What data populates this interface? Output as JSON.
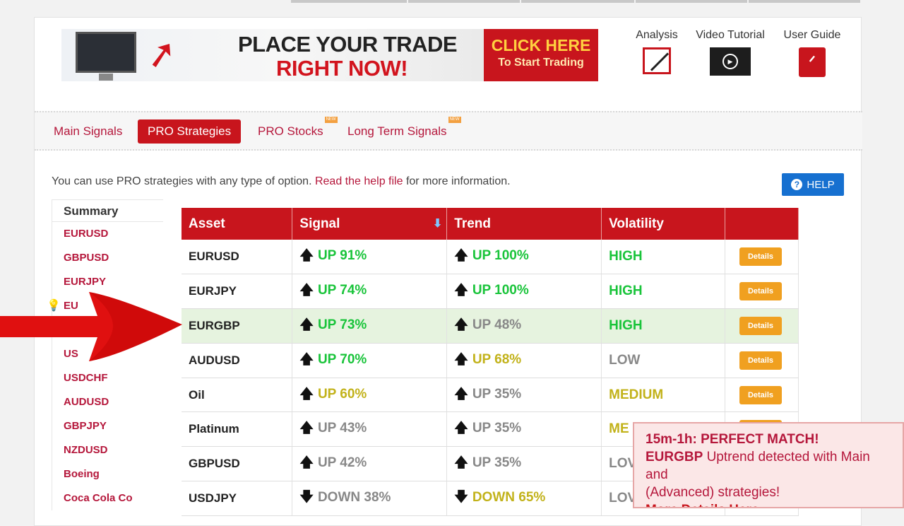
{
  "banner": {
    "line1": "PLACE YOUR TRADE",
    "line2": "RIGHT NOW!",
    "cta_line1": "CLICK HERE",
    "cta_line2": "To Start Trading"
  },
  "tools": [
    {
      "label": "Analysis",
      "icon": "analysis-icon"
    },
    {
      "label": "Video Tutorial",
      "icon": "video-play-icon"
    },
    {
      "label": "User Guide",
      "icon": "pdf-icon"
    }
  ],
  "tabs": [
    {
      "label": "Main Signals",
      "active": false,
      "new": false
    },
    {
      "label": "PRO Strategies",
      "active": true,
      "new": false
    },
    {
      "label": "PRO Stocks",
      "active": false,
      "new": true
    },
    {
      "label": "Long Term Signals",
      "active": false,
      "new": true
    }
  ],
  "new_badge": "NEW",
  "info": {
    "before": "You can use PRO strategies with any type of option. ",
    "link": "Read the help file",
    "after": " for more information."
  },
  "help_label": "HELP",
  "sidebar": {
    "title": "Summary",
    "items": [
      "EURUSD",
      "GBPUSD",
      "EURJPY",
      "EU",
      "",
      "US",
      "USDCHF",
      "AUDUSD",
      "GBPJPY",
      "NZDUSD",
      "Boeing",
      "Coca Cola Co"
    ]
  },
  "table": {
    "headers": [
      "Asset",
      "Signal",
      "Trend",
      "Volatility",
      ""
    ],
    "details_label": "Details",
    "rows": [
      {
        "asset": "EURUSD",
        "signal_dir": "up",
        "signal": "UP 91%",
        "signal_color": "green",
        "trend_dir": "up",
        "trend": "UP 100%",
        "trend_color": "green",
        "vol": "HIGH",
        "vol_color": "green"
      },
      {
        "asset": "EURJPY",
        "signal_dir": "up",
        "signal": "UP 74%",
        "signal_color": "green",
        "trend_dir": "up",
        "trend": "UP 100%",
        "trend_color": "green",
        "vol": "HIGH",
        "vol_color": "green"
      },
      {
        "asset": "EURGBP",
        "signal_dir": "up",
        "signal": "UP 73%",
        "signal_color": "green",
        "trend_dir": "up",
        "trend": "UP 48%",
        "trend_color": "gray",
        "vol": "HIGH",
        "vol_color": "green",
        "highlight": true
      },
      {
        "asset": "AUDUSD",
        "signal_dir": "up",
        "signal": "UP 70%",
        "signal_color": "green",
        "trend_dir": "up",
        "trend": "UP 68%",
        "trend_color": "yellow",
        "vol": "LOW",
        "vol_color": "gray"
      },
      {
        "asset": "Oil",
        "signal_dir": "up",
        "signal": "UP 60%",
        "signal_color": "yellow",
        "trend_dir": "up",
        "trend": "UP 35%",
        "trend_color": "gray",
        "vol": "MEDIUM",
        "vol_color": "yellow"
      },
      {
        "asset": "Platinum",
        "signal_dir": "up",
        "signal": "UP 43%",
        "signal_color": "gray",
        "trend_dir": "up",
        "trend": "UP 35%",
        "trend_color": "gray",
        "vol": "ME",
        "vol_color": "yellow"
      },
      {
        "asset": "GBPUSD",
        "signal_dir": "up",
        "signal": "UP 42%",
        "signal_color": "gray",
        "trend_dir": "up",
        "trend": "UP 35%",
        "trend_color": "gray",
        "vol": "LOV",
        "vol_color": "gray"
      },
      {
        "asset": "USDJPY",
        "signal_dir": "down",
        "signal": "DOWN 38%",
        "signal_color": "gray",
        "trend_dir": "down",
        "trend": "DOWN 65%",
        "trend_color": "yellow",
        "vol": "LOV",
        "vol_color": "gray"
      }
    ]
  },
  "toast": {
    "title": "15m-1h: PERFECT MATCH!",
    "asset": "EURGBP",
    "text1": " Uptrend detected with Main and",
    "text2": "(Advanced) strategies!",
    "more": "More Details Here"
  }
}
